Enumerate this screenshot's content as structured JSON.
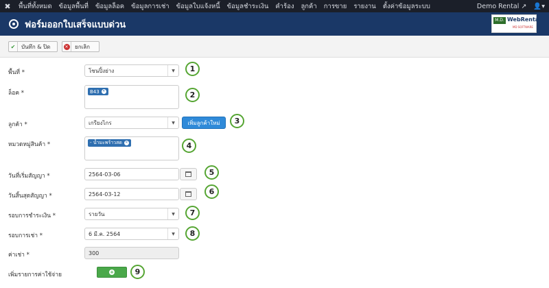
{
  "topnav": {
    "menu": [
      "พื้นที่ทั้งหมด",
      "ข้อมูลพื้นที่",
      "ข้อมูลล็อค",
      "ข้อมูลการเช่า",
      "ข้อมูลใบแจ้งหนี้",
      "ข้อมูลชำระเงิน",
      "คำร้อง",
      "ลูกค้า",
      "การขาย",
      "รายงาน",
      "ตั้งค่าข้อมูลระบบ"
    ],
    "site": "Demo Rental"
  },
  "header": {
    "title": "ฟอร์มออกใบเสร็จแบบด่วน"
  },
  "logo": {
    "md": "M.D.",
    "brand": "WebRental",
    "sub": "MD SOFTWARE"
  },
  "toolbar": {
    "save_label": "บันทึก & ปิด",
    "cancel_label": "ยกเลิก"
  },
  "form": {
    "area_label": "พื้นที่ *",
    "area_value": "โซนปิ้งย่าง",
    "lock_label": "ล็อค *",
    "lock_tag": "B43",
    "customer_label": "ลูกค้า *",
    "customer_value": "เกรียงไกร",
    "add_customer": "เพิ่มลูกค้าใหม่",
    "category_label": "หมวดหมู่สินค้า *",
    "category_tag": "- น้ำมะพร้าวสด",
    "start_label": "วันที่เริ่มสัญญา *",
    "start_value": "2564-03-06",
    "end_label": "วันสิ้นสุดสัญญา *",
    "end_value": "2564-03-12",
    "payment_label": "รอบการชำระเงิน *",
    "payment_value": "รายวัน",
    "rent_round_label": "รอบการเช่า *",
    "rent_round_value": "6 มี.ค. 2564",
    "rent_fee_label": "ค่าเช่า *",
    "rent_fee_value": "300",
    "add_expense_label": "เพิ่มรายการค่าใช้จ่าย"
  },
  "markers": [
    "1",
    "2",
    "3",
    "4",
    "5",
    "6",
    "7",
    "8",
    "9"
  ],
  "colors": {
    "topnav": "#1b1f29",
    "header": "#1a3867",
    "marker_ring": "#55a532",
    "tag": "#2f6fb0",
    "add_customer": "#2f8ad9",
    "add_expense": "#4aa84a"
  }
}
